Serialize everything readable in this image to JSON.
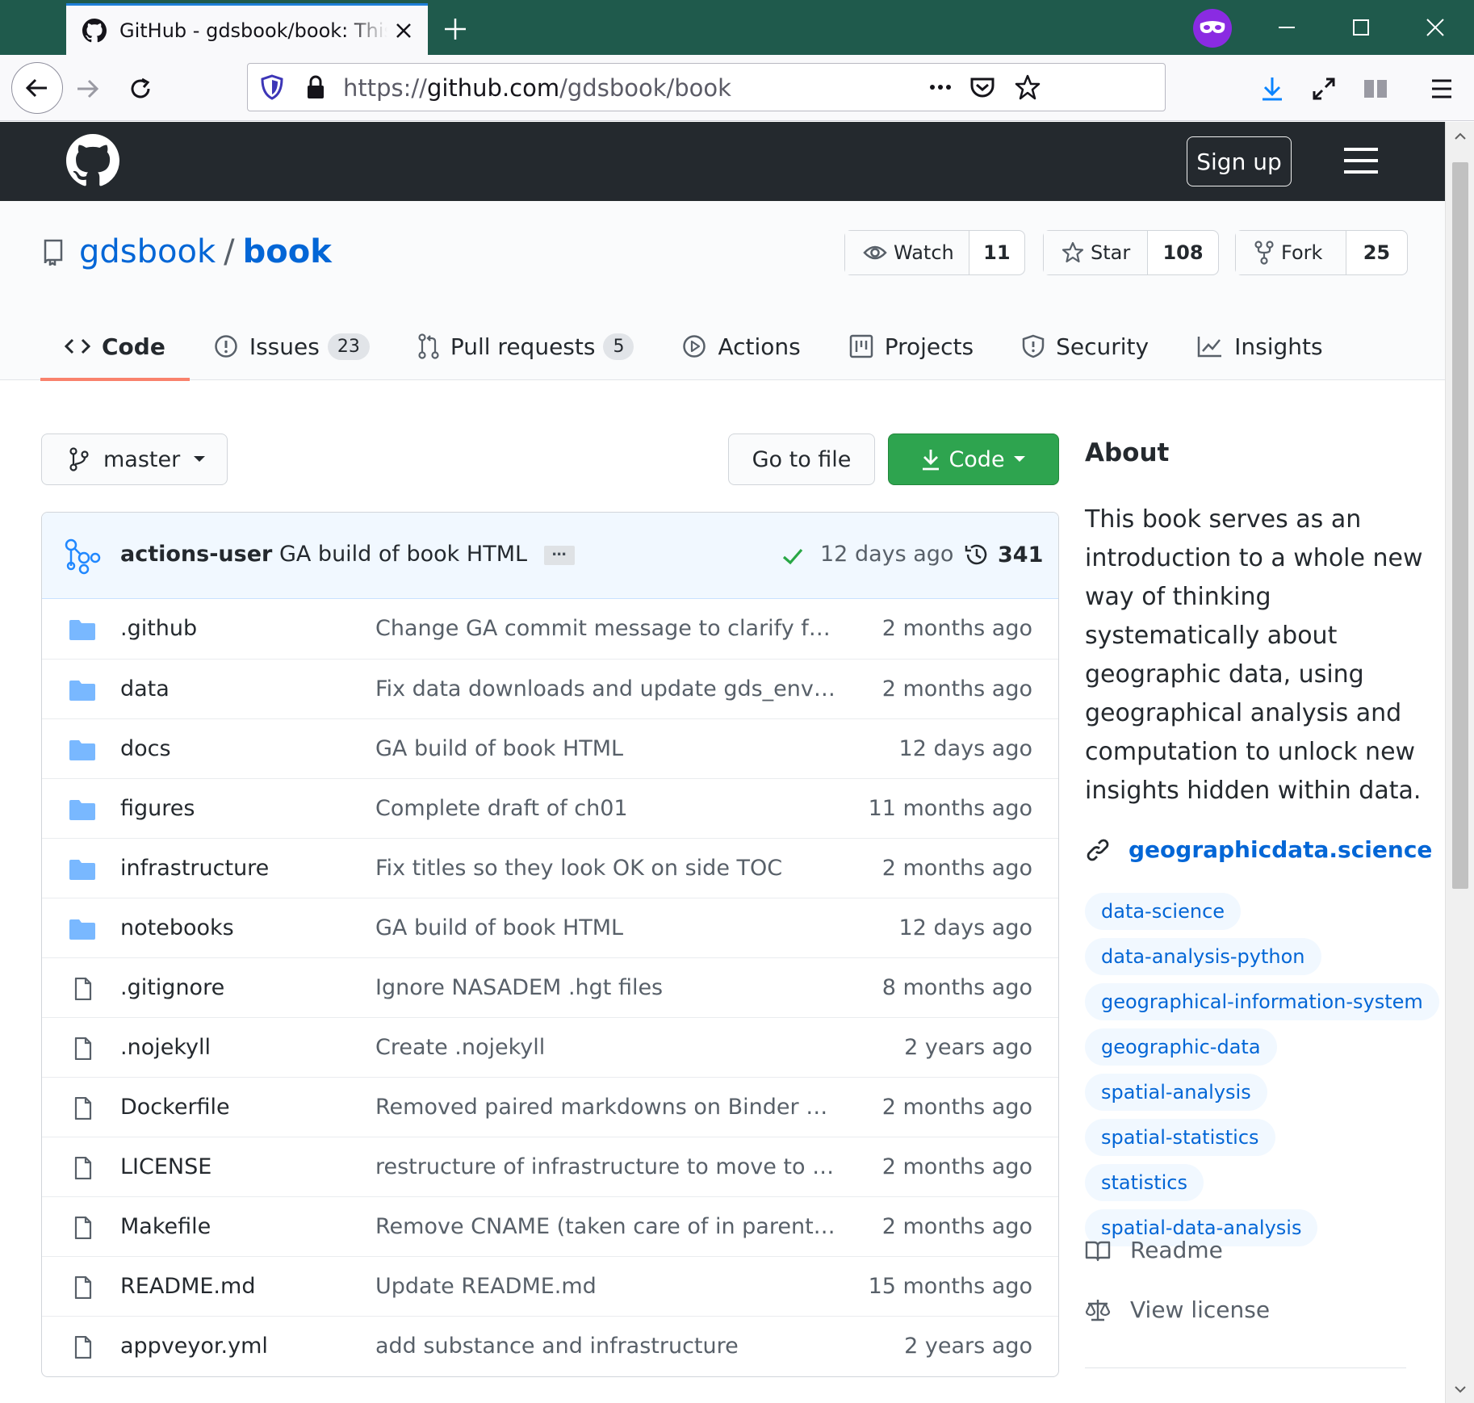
{
  "browser": {
    "tab_title": "GitHub - gdsbook/book: This book serves as an introduction to a whole new way of thinking",
    "url_prefix": "https://",
    "url_domain": "github.com",
    "url_path": "/gdsbook/book"
  },
  "header": {
    "signup_label": "Sign up"
  },
  "repo": {
    "owner": "gdsbook",
    "separator": "/",
    "name": "book",
    "watch_label": "Watch",
    "watch_count": "11",
    "star_label": "Star",
    "star_count": "108",
    "fork_label": "Fork",
    "fork_count": "25"
  },
  "tabs": [
    {
      "label": "Code",
      "icon": "code-icon"
    },
    {
      "label": "Issues",
      "icon": "issue-icon",
      "badge": "23"
    },
    {
      "label": "Pull requests",
      "icon": "pull-request-icon",
      "badge": "5"
    },
    {
      "label": "Actions",
      "icon": "play-icon"
    },
    {
      "label": "Projects",
      "icon": "project-icon"
    },
    {
      "label": "Security",
      "icon": "shield-icon"
    },
    {
      "label": "Insights",
      "icon": "graph-icon"
    }
  ],
  "toolbar": {
    "branch": "master",
    "go_to_file": "Go to file",
    "code": "Code"
  },
  "last_commit": {
    "author": "actions-user",
    "message": "GA build of book HTML",
    "ellipsis": "…",
    "time": "12 days ago",
    "commit_count": "341"
  },
  "files": [
    {
      "name": ".github",
      "type": "dir",
      "message": "Change GA commit message to clarify further",
      "age": "2 months ago"
    },
    {
      "name": "data",
      "type": "dir",
      "message": "Fix data downloads and update gds_env for …",
      "age": "2 months ago"
    },
    {
      "name": "docs",
      "type": "dir",
      "message": "GA build of book HTML",
      "age": "12 days ago"
    },
    {
      "name": "figures",
      "type": "dir",
      "message": "Complete draft of ch01",
      "age": "11 months ago"
    },
    {
      "name": "infrastructure",
      "type": "dir",
      "message": "Fix titles so they look OK on side TOC",
      "age": "2 months ago"
    },
    {
      "name": "notebooks",
      "type": "dir",
      "message": "GA build of book HTML",
      "age": "12 days ago"
    },
    {
      "name": ".gitignore",
      "type": "file",
      "message": "Ignore NASADEM .hgt files",
      "age": "8 months ago"
    },
    {
      "name": ".nojekyll",
      "type": "file",
      "message": "Create .nojekyll",
      "age": "2 years ago"
    },
    {
      "name": "Dockerfile",
      "type": "file",
      "message": "Removed paired markdowns on Binder setup",
      "age": "2 months ago"
    },
    {
      "name": "LICENSE",
      "type": "file",
      "message": "restructure of infrastructure to move to new JB",
      "age": "2 months ago"
    },
    {
      "name": "Makefile",
      "type": "file",
      "message": "Remove CNAME (taken care of in parent rep…",
      "age": "2 months ago"
    },
    {
      "name": "README.md",
      "type": "file",
      "message": "Update README.md",
      "age": "15 months ago"
    },
    {
      "name": "appveyor.yml",
      "type": "file",
      "message": "add substance and infrastructure",
      "age": "2 years ago"
    }
  ],
  "about": {
    "heading": "About",
    "description": "This book serves as an introduction to a whole new way of thinking systematically about geographic data, using geographical analysis and computation to unlock new insights hidden within data.",
    "website": "geographicdata.science",
    "topics": [
      "data-science",
      "data-analysis-python",
      "geographical-information-system",
      "geographic-data",
      "spatial-analysis",
      "spatial-statistics",
      "statistics",
      "spatial-data-analysis"
    ],
    "readme_label": "Readme",
    "license_label": "View license"
  },
  "colors": {
    "tabbar": "#1f5a4c",
    "gh_header": "#24292e",
    "link_blue": "#0366d6",
    "code_green": "#2ea44f",
    "active_tab_underline": "#f9826c",
    "folder_blue": "#79b8ff"
  }
}
